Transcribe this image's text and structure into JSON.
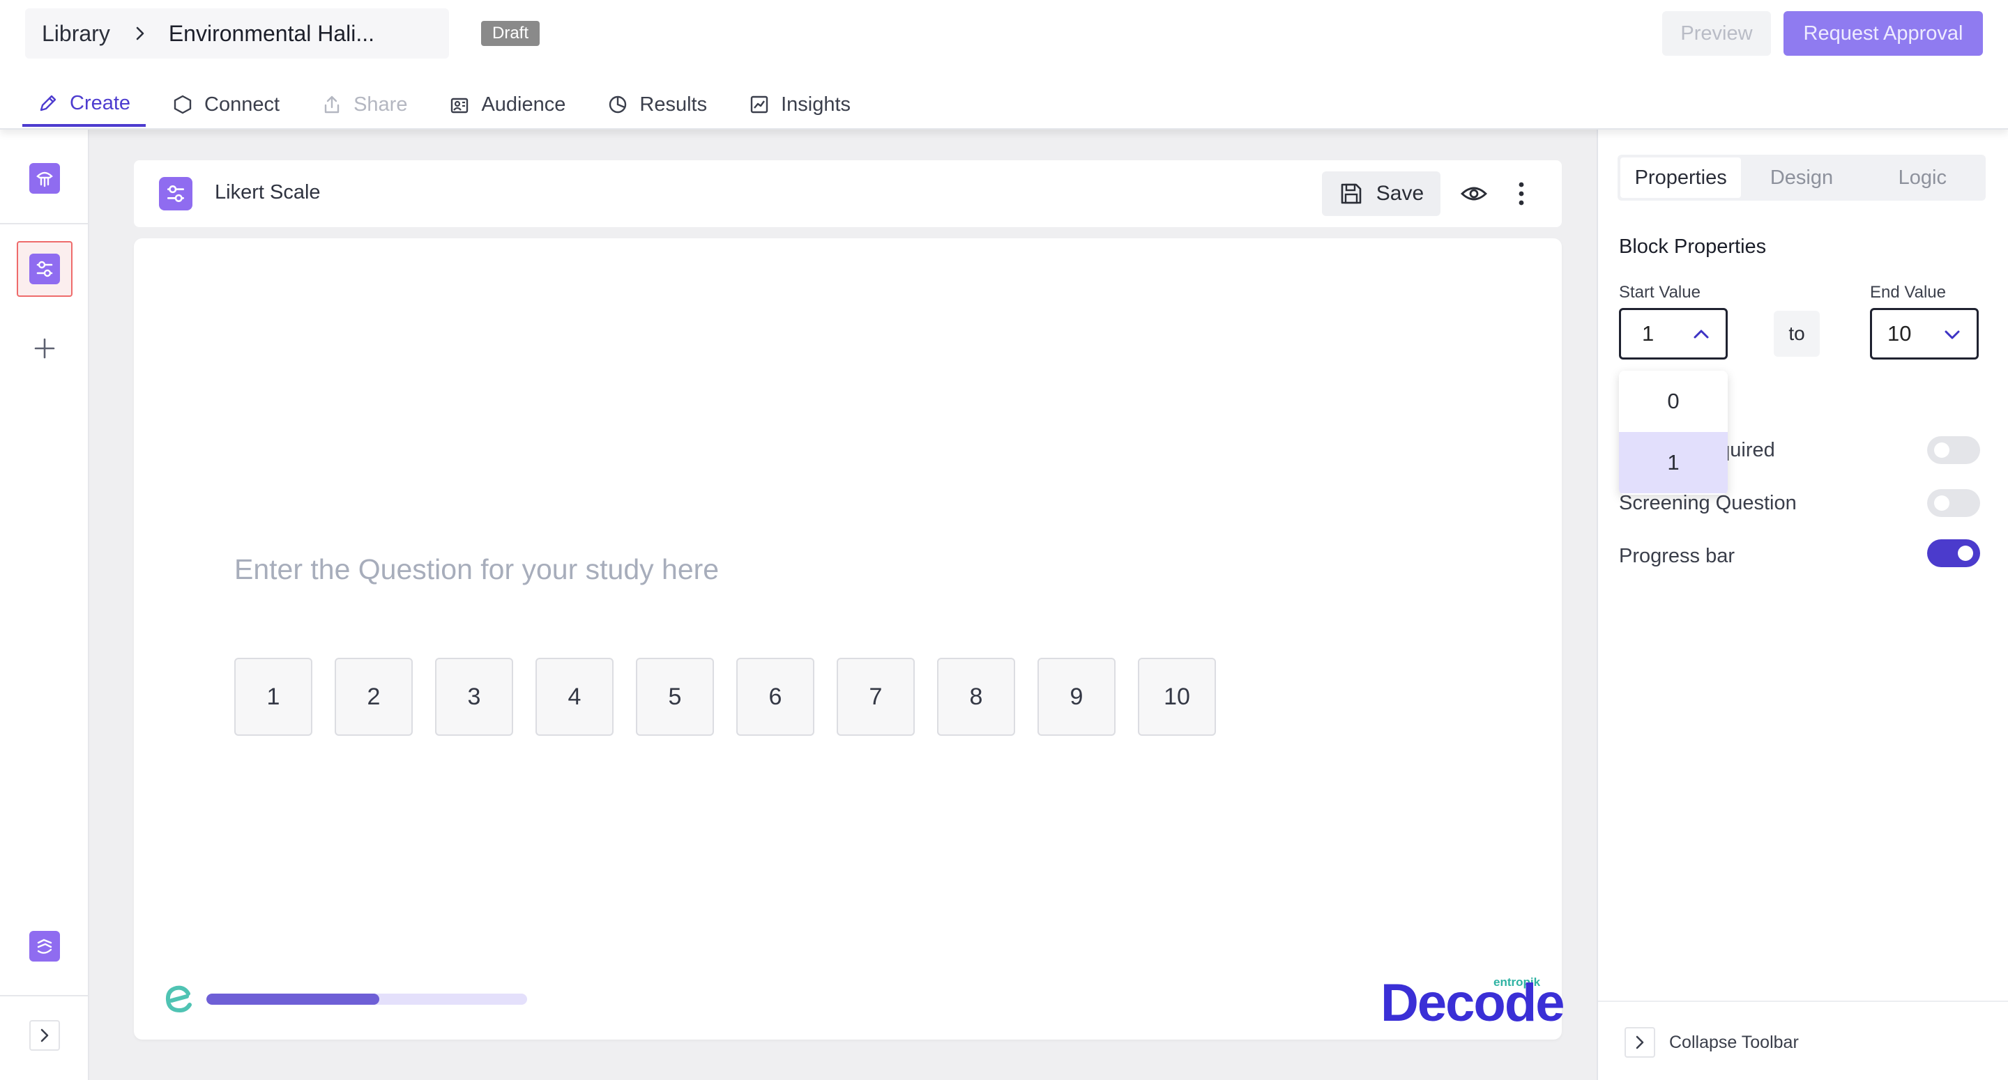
{
  "header": {
    "breadcrumb_root": "Library",
    "breadcrumb_title": "Environmental Hali...",
    "status_badge": "Draft",
    "preview_label": "Preview",
    "request_approval_label": "Request Approval"
  },
  "tabs": [
    {
      "label": "Create",
      "icon": "pencil-icon",
      "state": "active"
    },
    {
      "label": "Connect",
      "icon": "hexagon-icon",
      "state": "normal"
    },
    {
      "label": "Share",
      "icon": "share-icon",
      "state": "disabled"
    },
    {
      "label": "Audience",
      "icon": "audience-icon",
      "state": "normal"
    },
    {
      "label": "Results",
      "icon": "pie-chart-icon",
      "state": "normal"
    },
    {
      "label": "Insights",
      "icon": "chart-line-icon",
      "state": "normal"
    }
  ],
  "block": {
    "type_label": "Likert Scale",
    "save_label": "Save",
    "question_placeholder": "Enter the Question for your study here",
    "scale_options": [
      "1",
      "2",
      "3",
      "4",
      "5",
      "6",
      "7",
      "8",
      "9",
      "10"
    ],
    "progress_fraction": 0.54,
    "brand_small": "entropik",
    "brand_big": "Decode"
  },
  "properties": {
    "tabs": [
      "Properties",
      "Design",
      "Logic"
    ],
    "active_tab": "Properties",
    "title": "Block Properties",
    "start_label": "Start Value",
    "start_value": "1",
    "to_label": "to",
    "end_label": "End Value",
    "end_value": "10",
    "dropdown_options": [
      "0",
      "1"
    ],
    "dropdown_selected": "1",
    "required_label": "Answer Required",
    "required_visible": "equired",
    "screening_label": "Screening Question",
    "progress_label": "Progress bar",
    "required_on": false,
    "screening_on": false,
    "progress_on": true,
    "collapse_label": "Collapse Toolbar"
  },
  "colors": {
    "accent": "#4d3ccf",
    "block_icon": "#8f6cf0",
    "toggle_on": "#4b3bcc"
  }
}
